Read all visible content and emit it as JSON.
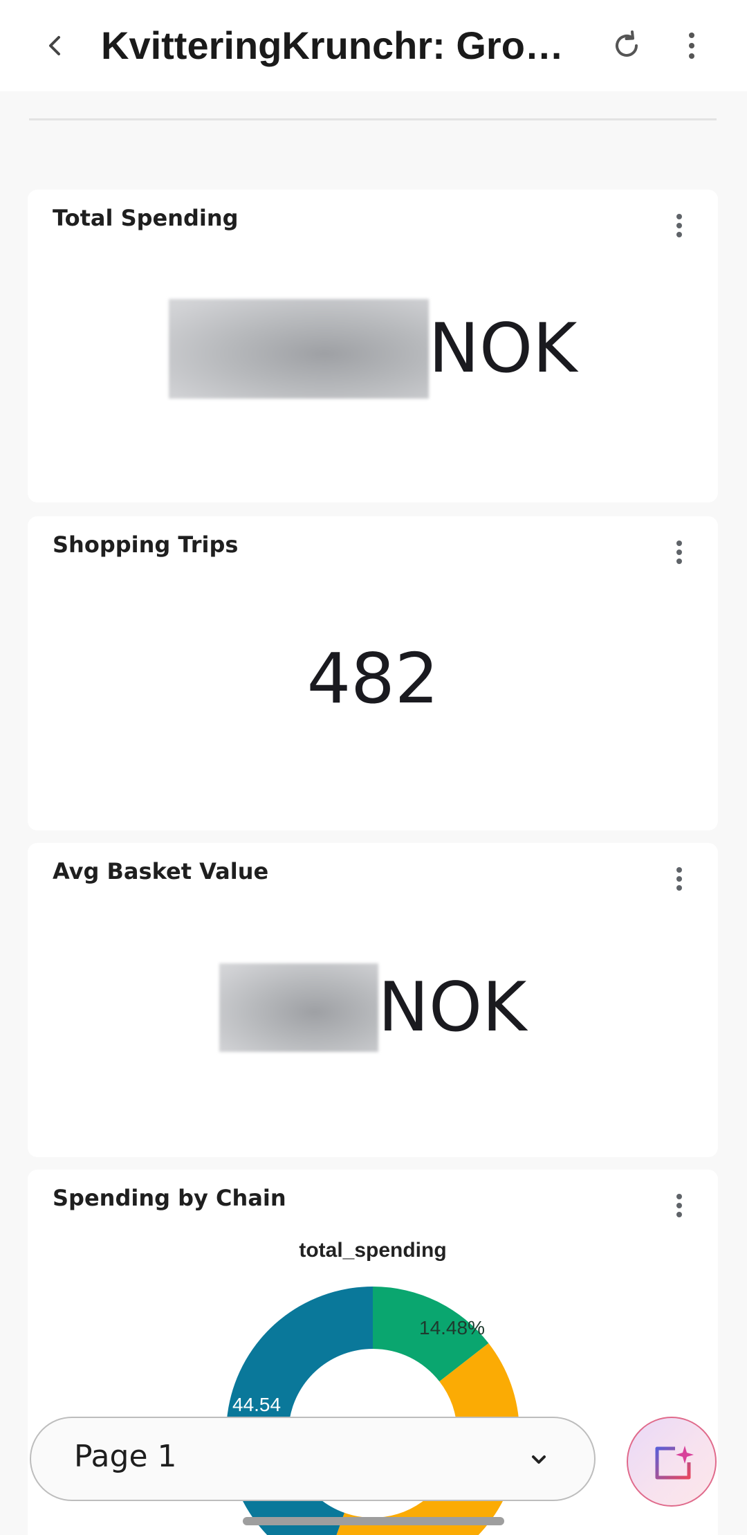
{
  "appbar": {
    "title": "KvitteringKrunchr: Grocer…",
    "back_icon": "arrow-back-icon",
    "refresh_icon": "refresh-icon",
    "more_icon": "more-vert-icon"
  },
  "cards": {
    "total_spending": {
      "title": "Total Spending",
      "unit": "NOK"
    },
    "shopping_trips": {
      "title": "Shopping Trips",
      "value": "482"
    },
    "avg_basket": {
      "title": "Avg Basket Value",
      "unit": "NOK"
    },
    "spending_by_chain": {
      "title": "Spending by Chain",
      "chart_title": "total_spending",
      "label_green": "14.48%",
      "label_blue": "44.54"
    }
  },
  "chart_data": {
    "type": "pie",
    "title": "total_spending",
    "donut": true,
    "slices": [
      {
        "label": "",
        "value": 14.48,
        "color": "#0aa66f"
      },
      {
        "label": "",
        "value": 40.98,
        "color": "#fbab04"
      },
      {
        "label": "",
        "value": 44.54,
        "color": "#0a789a"
      }
    ]
  },
  "footer": {
    "page_select_value": "Page 1",
    "chevron_icon": "chevron-down-icon",
    "fab_icon": "ai-insights-icon"
  },
  "colors": {
    "background": "#f8f8f8",
    "card": "#ffffff",
    "green": "#0aa66f",
    "yellow": "#fbab04",
    "blue": "#0a789a"
  }
}
